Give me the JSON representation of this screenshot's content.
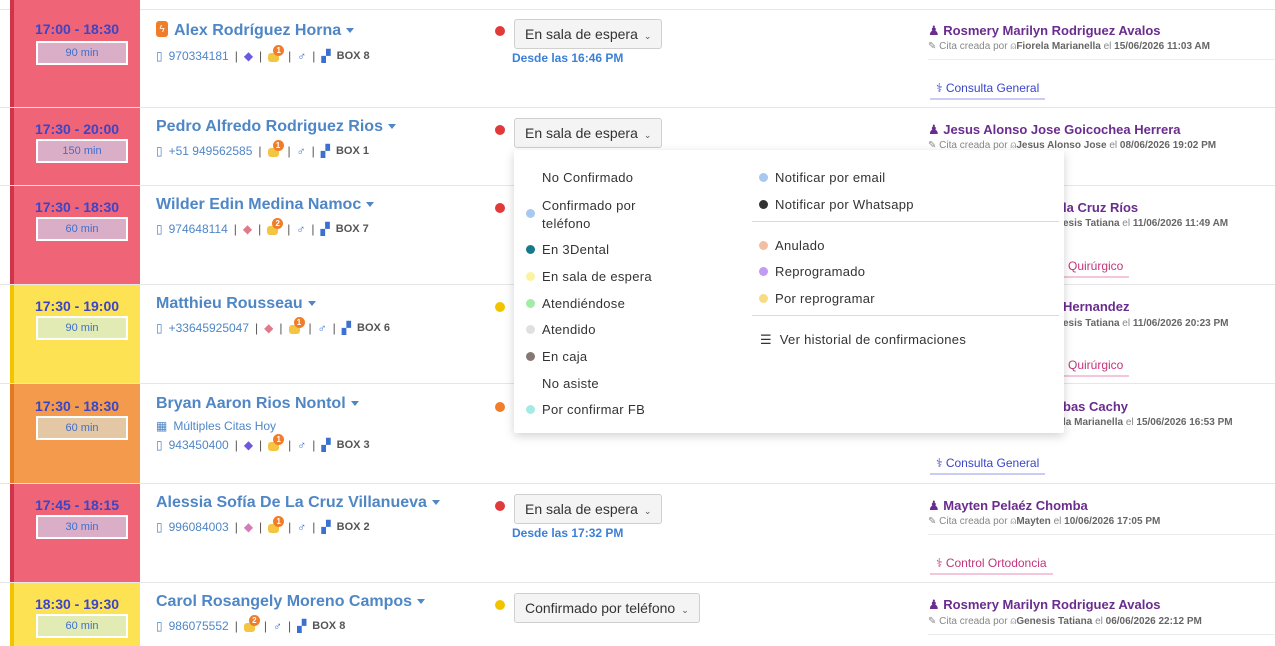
{
  "rows": [
    {
      "time": "17:00 - 18:30",
      "duration": "90 min",
      "name": "Alex Rodríguez Horna",
      "phone": "970334181",
      "box": "BOX 8",
      "messages": "1",
      "status": "En sala de espera",
      "since": "Desde las 16:46 PM",
      "doctor": "Rosmery Marilyn Rodriguez Avalos",
      "created_prefix": "Cita creada por",
      "created_by": "Fiorela Marianella",
      "created_mid": "el",
      "created_at": "15/06/2026 11:03 AM",
      "tag": "Consulta General"
    },
    {
      "time": "17:30 - 20:00",
      "duration": "150 min",
      "name": "Pedro Alfredo Rodriguez Rios",
      "phone": "+51 949562585",
      "box": "BOX 1",
      "messages": "1",
      "status": "En sala de espera",
      "doctor": "Jesus Alonso Jose Goicochea Herrera",
      "created_prefix": "Cita creada por",
      "created_by": "Jesus Alonso Jose",
      "created_mid": "el",
      "created_at": "08/06/2026 19:02 PM"
    },
    {
      "time": "17:30 - 18:30",
      "duration": "60 min",
      "name": "Wilder Edin Medina Namoc",
      "phone": "974648114",
      "box": "BOX 7",
      "messages": "2",
      "doctor_partial": "la Cruz Ríos",
      "created_partial_by": "esis Tatiana",
      "created_mid": "el",
      "created_at": "11/06/2026 11:49 AM",
      "tag_partial": "Quirúrgico"
    },
    {
      "time": "17:30 - 19:00",
      "duration": "90 min",
      "name": "Matthieu Rousseau",
      "phone": "+33645925047",
      "box": "BOX 6",
      "messages": "1",
      "doctor_partial": "Hernandez",
      "created_partial_by": "esis Tatiana",
      "created_mid": "el",
      "created_at": "11/06/2026 20:23 PM",
      "tag_partial": "Quirúrgico"
    },
    {
      "time": "17:30 - 18:30",
      "duration": "60 min",
      "name": "Bryan Aaron Rios Nontol",
      "multiple": "Múltiples Citas Hoy",
      "phone": "943450400",
      "box": "BOX 3",
      "messages": "1",
      "doctor_partial": "bas Cachy",
      "created_partial_by": "la Marianella",
      "created_mid": "el",
      "created_at": "15/06/2026 16:53 PM",
      "tag": "Consulta General"
    },
    {
      "time": "17:45 - 18:15",
      "duration": "30 min",
      "name": "Alessia Sofía De La Cruz Villanueva",
      "phone": "996084003",
      "box": "BOX 2",
      "messages": "1",
      "status": "En sala de espera",
      "since": "Desde las 17:32 PM",
      "doctor": "Mayten Pelaéz Chomba",
      "created_prefix": "Cita creada por",
      "created_by": "Mayten",
      "created_mid": "el",
      "created_at": "10/06/2026 17:05 PM",
      "tag": "Control Ortodoncia"
    },
    {
      "time": "18:30 - 19:30",
      "duration": "60 min",
      "name": "Carol Rosangely Moreno Campos",
      "phone": "986075552",
      "box": "BOX 8",
      "messages": "2",
      "status": "Confirmado por teléfono",
      "doctor": "Rosmery Marilyn Rodriguez Avalos",
      "created_prefix": "Cita creada por",
      "created_by": "Genesis Tatiana",
      "created_mid": "el",
      "created_at": "06/06/2026 22:12 PM"
    }
  ],
  "menu": {
    "left": [
      {
        "label": "No Confirmado",
        "color": ""
      },
      {
        "label": "Confirmado por",
        "label2": "teléfono",
        "color": "#a9c8f0"
      },
      {
        "label": "En 3Dental",
        "color": "#167a8c"
      },
      {
        "label": "En sala de espera",
        "color": "#faf3a0"
      },
      {
        "label": "Atendiéndose",
        "color": "#a5eba8"
      },
      {
        "label": "Atendido",
        "color": "#e0e0e0"
      },
      {
        "label": "En caja",
        "color": "#857872"
      },
      {
        "label": "No asiste",
        "color": ""
      },
      {
        "label": "Por confirmar FB",
        "color": "#a6eae7"
      }
    ],
    "right_top": [
      {
        "label": "Notificar por email",
        "color": "#a9c8f0"
      },
      {
        "label": "Notificar por Whatsapp",
        "color": "#333333"
      }
    ],
    "right_mid": [
      {
        "label": "Anulado",
        "color": "#f2c0a0"
      },
      {
        "label": "Reprogramado",
        "color": "#c39bf0"
      },
      {
        "label": "Por reprogramar",
        "color": "#f8dc84"
      }
    ],
    "history": "Ver historial de confirmaciones"
  },
  "colors": {
    "red_row": "#ef6477",
    "yellow_row": "#fde254",
    "orange_row": "#f39a4d",
    "name_blue": "#4f86c6",
    "doctor_purple": "#6a2c8e"
  }
}
